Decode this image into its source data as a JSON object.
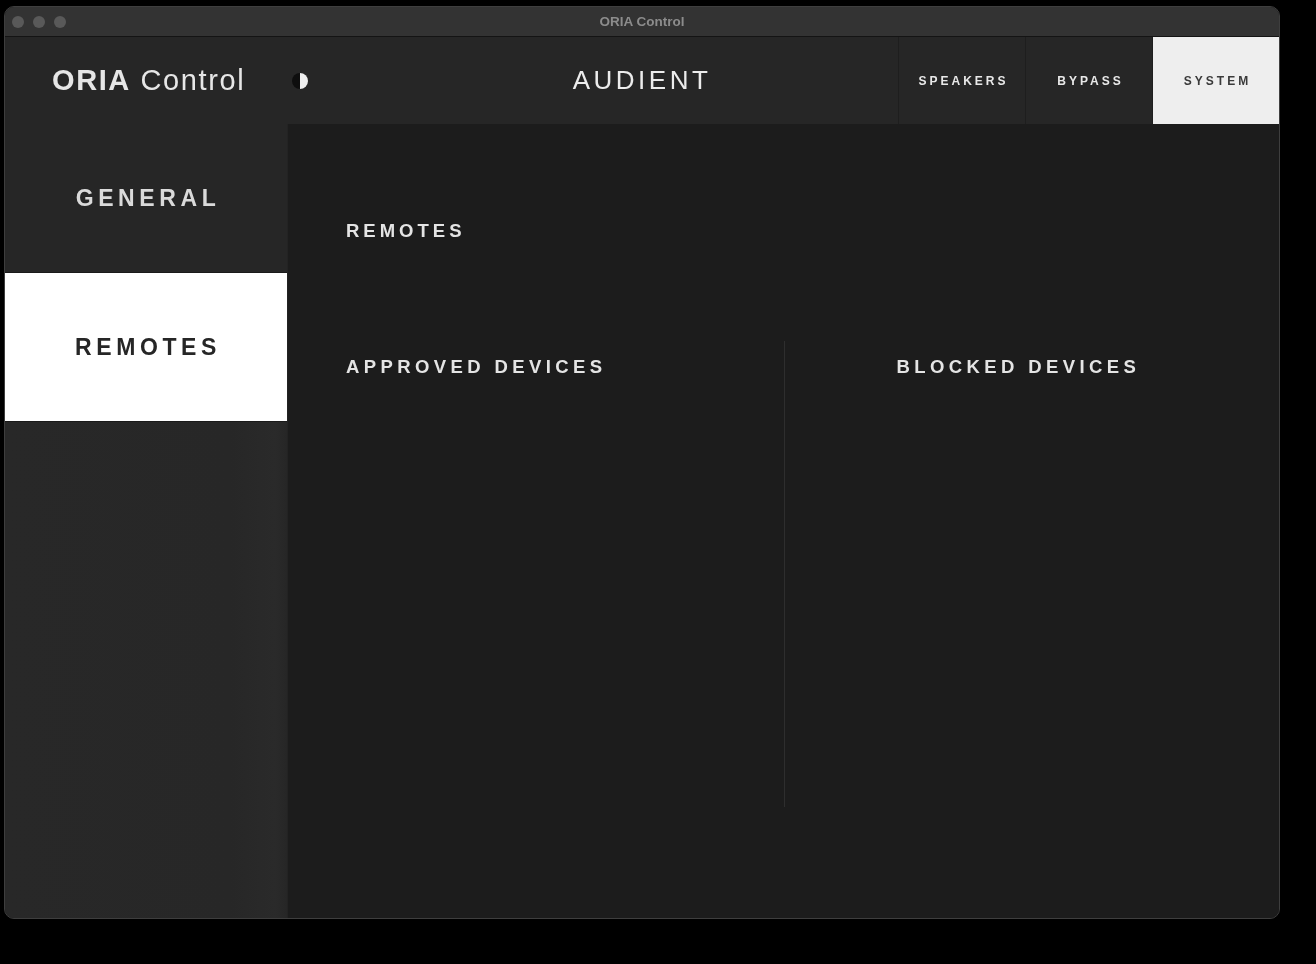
{
  "window": {
    "title": "ORIA Control"
  },
  "header": {
    "logo": "**ORIA** Control",
    "brand": "AUDIENT"
  },
  "tabs": [
    {
      "label": "SPEAKERS",
      "selected": false
    },
    {
      "label": "BYPASS",
      "selected": false
    },
    {
      "label": "SYSTEM",
      "selected": true
    }
  ],
  "sidebar": {
    "items": [
      {
        "label": "GENERAL",
        "selected": false
      },
      {
        "label": "REMOTES",
        "selected": true
      }
    ]
  },
  "content": {
    "title": "REMOTES",
    "columns": [
      {
        "heading": "APPROVED DEVICES"
      },
      {
        "heading": "BLOCKED DEVICES"
      }
    ]
  }
}
